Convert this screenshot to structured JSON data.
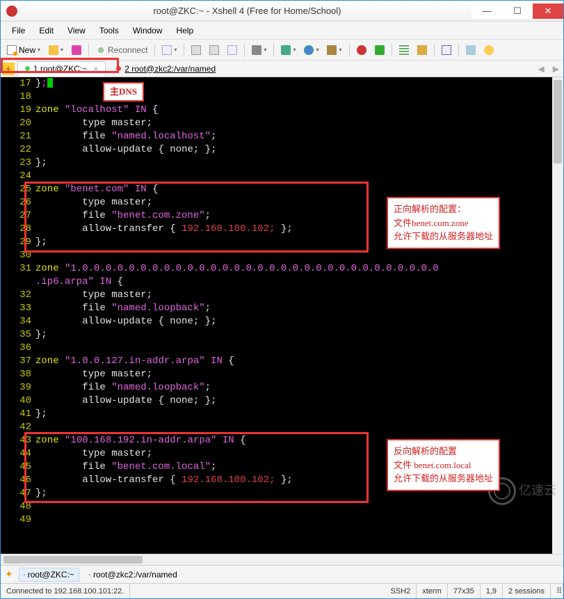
{
  "title": "root@ZKC:~ - Xshell 4 (Free for Home/School)",
  "menus": [
    "File",
    "Edit",
    "View",
    "Tools",
    "Window",
    "Help"
  ],
  "toolbar": {
    "new_label": "New",
    "reconnect_label": "Reconnect"
  },
  "tabs": [
    {
      "label": "1 root@ZKC:~",
      "active": true
    },
    {
      "label": "2 root@zkc2:/var/named",
      "active": false
    }
  ],
  "annot_main": "主DNS",
  "annot_fwd": {
    "l1": "正向解析的配置：",
    "l2": "文件benet.com.zone",
    "l3": "允许下载的从服务器地址"
  },
  "annot_rev": {
    "l1": "反向解析的配置",
    "l2": "文件 benet.com.local",
    "l3": "允许下载的从服务器地址"
  },
  "lines": {
    "17": "};",
    "19_a": "zone ",
    "19_b": "\"localhost\" IN ",
    "19_c": "{",
    "20": "        type master;",
    "21_a": "        file ",
    "21_b": "\"named.localhost\"",
    "21_c": ";",
    "22_a": "        allow-update ",
    "22_b": "{",
    "22_c": " none; ",
    "22_d": "}",
    "22_e": ";",
    "23": "};",
    "25_a": "zone ",
    "25_b": "\"benet.com\" IN ",
    "25_c": "{",
    "26": "        type master;",
    "27_a": "        file ",
    "27_b": "\"benet.com.zone\"",
    "27_c": ";",
    "28_a": "        allow-transfer ",
    "28_b": "{",
    "28_c": " 192.168.100.102; ",
    "28_d": "}",
    "28_e": ";",
    "29": "};",
    "31_a": "zone ",
    "31_b": "\"1.0.0.0.0.0.0.0.0.0.0.0.0.0.0.0.0.0.0.0.0.0.0.0.0.0.0.0.0.0.0.0",
    "31c_a": ".ip6.arpa\" IN ",
    "31c_b": "{",
    "32": "        type master;",
    "33_a": "        file ",
    "33_b": "\"named.loopback\"",
    "33_c": ";",
    "34_a": "        allow-update ",
    "34_b": "{",
    "34_c": " none; ",
    "34_d": "}",
    "34_e": ";",
    "35": "};",
    "37_a": "zone ",
    "37_b": "\"1.0.0.127.in-addr.arpa\" IN ",
    "37_c": "{",
    "38": "        type master;",
    "39_a": "        file ",
    "39_b": "\"named.loopback\"",
    "39_c": ";",
    "40_a": "        allow-update ",
    "40_b": "{",
    "40_c": " none; ",
    "40_d": "}",
    "40_e": ";",
    "41": "};",
    "43_a": "zone ",
    "43_b": "\"100.168.192.in-addr.arpa\" IN ",
    "43_c": "{",
    "44": "        type master;",
    "45_a": "        file ",
    "45_b": "\"benet.com.local\"",
    "45_c": ";",
    "46_a": "        allow-transfer ",
    "46_b": "{",
    "46_c": " 192.168.100.102; ",
    "46_d": "}",
    "46_e": ";",
    "47": "};"
  },
  "line_nums": [
    "17",
    "18",
    "19",
    "20",
    "21",
    "22",
    "23",
    "24",
    "25",
    "26",
    "27",
    "28",
    "29",
    "30",
    "31",
    "",
    "32",
    "33",
    "34",
    "35",
    "36",
    "37",
    "38",
    "39",
    "40",
    "41",
    "42",
    "43",
    "44",
    "45",
    "46",
    "47",
    "48",
    "49"
  ],
  "sessions": [
    {
      "label": "root@ZKC:~",
      "active": true
    },
    {
      "label": "root@zkc2:/var/named",
      "active": false
    }
  ],
  "status": {
    "conn": "Connected to 192.168.100.101:22.",
    "proto": "SSH2",
    "term": "xterm",
    "size": "77x35",
    "pos": "1,9",
    "sess": "2 sessions"
  },
  "watermark": "亿速云"
}
